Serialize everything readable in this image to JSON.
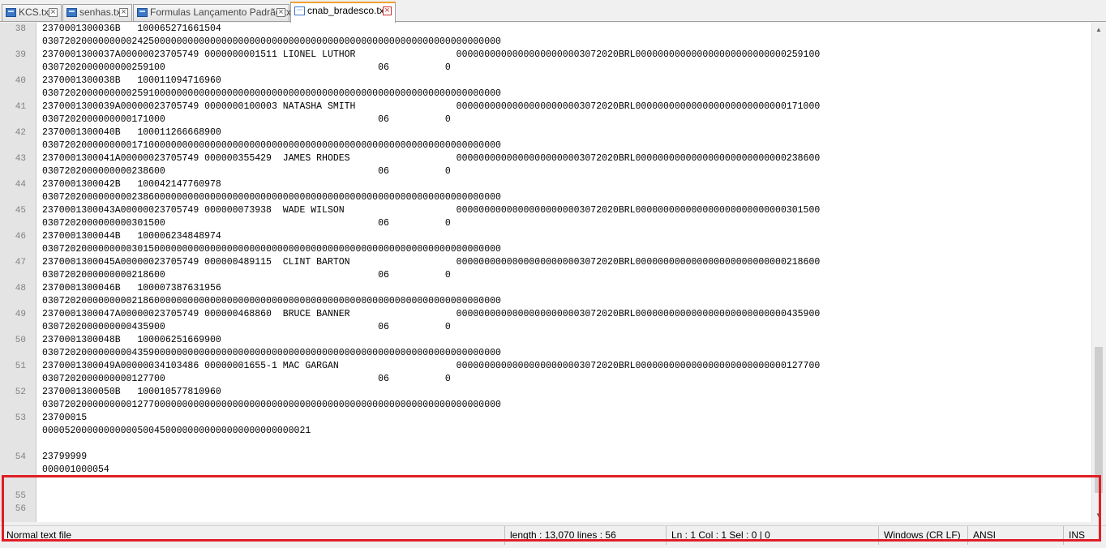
{
  "tabs": [
    {
      "label": "KCS.txt",
      "active": false
    },
    {
      "label": "senhas.txt",
      "active": false
    },
    {
      "label": "Formulas Lançamento Padrão.txt",
      "active": false
    },
    {
      "label": "cnab_bradesco.txt",
      "active": true
    }
  ],
  "editor": {
    "rows": [
      {
        "ln": "38",
        "text": "2370001300036B   100065271661504"
      },
      {
        "ln": "",
        "text": "0307202000000000242500000000000000000000000000000000000000000000000000000000000000"
      },
      {
        "ln": "39",
        "text": "2370001300037A00000023705749 0000000001511 LIONEL LUTHOR                  00000000000000000000003072020BRL000000000000000000000000000259100"
      },
      {
        "ln": "",
        "text": "0307202000000000259100                                      06          0"
      },
      {
        "ln": "40",
        "text": "2370001300038B   100011094716960"
      },
      {
        "ln": "",
        "text": "0307202000000000259100000000000000000000000000000000000000000000000000000000000000"
      },
      {
        "ln": "41",
        "text": "2370001300039A00000023705749 0000000100003 NATASHA SMITH                  00000000000000000000003072020BRL000000000000000000000000000171000"
      },
      {
        "ln": "",
        "text": "0307202000000000171000                                      06          0"
      },
      {
        "ln": "42",
        "text": "2370001300040B   100011266668900"
      },
      {
        "ln": "",
        "text": "0307202000000000171000000000000000000000000000000000000000000000000000000000000000"
      },
      {
        "ln": "43",
        "text": "2370001300041A00000023705749 000000355429  JAMES RHODES                   00000000000000000000003072020BRL000000000000000000000000000238600"
      },
      {
        "ln": "",
        "text": "0307202000000000238600                                      06          0"
      },
      {
        "ln": "44",
        "text": "2370001300042B   100042147760978"
      },
      {
        "ln": "",
        "text": "0307202000000000238600000000000000000000000000000000000000000000000000000000000000"
      },
      {
        "ln": "45",
        "text": "2370001300043A00000023705749 000000073938  WADE WILSON                    00000000000000000000003072020BRL000000000000000000000000000301500"
      },
      {
        "ln": "",
        "text": "0307202000000000301500                                      06          0"
      },
      {
        "ln": "46",
        "text": "2370001300044B   100006234848974"
      },
      {
        "ln": "",
        "text": "0307202000000000301500000000000000000000000000000000000000000000000000000000000000"
      },
      {
        "ln": "47",
        "text": "2370001300045A00000023705749 000000489115  CLINT BARTON                   00000000000000000000003072020BRL000000000000000000000000000218600"
      },
      {
        "ln": "",
        "text": "0307202000000000218600                                      06          0"
      },
      {
        "ln": "48",
        "text": "2370001300046B   100007387631956"
      },
      {
        "ln": "",
        "text": "0307202000000000218600000000000000000000000000000000000000000000000000000000000000"
      },
      {
        "ln": "49",
        "text": "2370001300047A00000023705749 000000468860  BRUCE BANNER                   00000000000000000000003072020BRL000000000000000000000000000435900"
      },
      {
        "ln": "",
        "text": "0307202000000000435900                                      06          0"
      },
      {
        "ln": "50",
        "text": "2370001300048B   100006251669900"
      },
      {
        "ln": "",
        "text": "0307202000000000435900000000000000000000000000000000000000000000000000000000000000"
      },
      {
        "ln": "51",
        "text": "2370001300049A00000034103486 00000001655-1 MAC GARGAN                     00000000000000000000003072020BRL000000000000000000000000000127700"
      },
      {
        "ln": "",
        "text": "0307202000000000127700                                      06          0"
      },
      {
        "ln": "52",
        "text": "2370001300050B   100010577810960"
      },
      {
        "ln": "",
        "text": "0307202000000000127700000000000000000000000000000000000000000000000000000000000000"
      },
      {
        "ln": "53",
        "text": "23700015"
      },
      {
        "ln": "",
        "text": "000052000000000005004500000000000000000000000021"
      },
      {
        "ln": "",
        "text": ""
      },
      {
        "ln": "54",
        "text": "23799999"
      },
      {
        "ln": "",
        "text": "000001000054"
      },
      {
        "ln": "",
        "text": ""
      },
      {
        "ln": "55",
        "text": ""
      },
      {
        "ln": "56",
        "text": ""
      }
    ]
  },
  "statusbar": {
    "file_type": "Normal text file",
    "length_lines": "length : 13,070    lines : 56",
    "position": "Ln : 1    Col : 1    Sel : 0 | 0",
    "eol": "Windows (CR LF)",
    "encoding": "ANSI",
    "mode": "INS"
  },
  "colors": {
    "highlight_box": "#e01e25",
    "active_tab_accent": "#f0a030"
  }
}
